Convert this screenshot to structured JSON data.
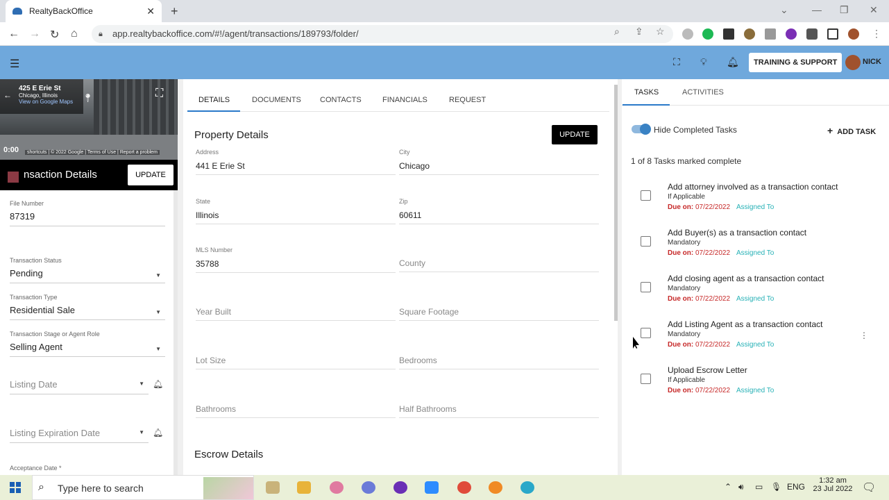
{
  "browser": {
    "tab_title": "RealtyBackOffice",
    "url": "app.realtybackoffice.com/#!/agent/transactions/189793/folder/"
  },
  "header": {
    "support_label": "TRAINING & SUPPORT",
    "user_name": "NICK"
  },
  "streetview": {
    "address": "425 E Erie St",
    "city": "Chicago, Illinois",
    "link": "View on Google Maps",
    "time": "0:00",
    "footer": "shortcuts | © 2022 Google | Terms of Use | Report a problem"
  },
  "left_panel": {
    "title": "nsaction Details",
    "update_label": "UPDATE",
    "file_number_label": "File Number",
    "file_number": "87319",
    "status_label": "Transaction Status",
    "status": "Pending",
    "type_label": "Transaction Type",
    "type": "Residential Sale",
    "stage_label": "Transaction Stage or Agent Role",
    "stage": "Selling Agent",
    "listing_date": "Listing Date",
    "listing_exp": "Listing Expiration Date",
    "acceptance_label": "Acceptance Date *"
  },
  "center": {
    "tabs": [
      "DETAILS",
      "DOCUMENTS",
      "CONTACTS",
      "FINANCIALS",
      "REQUEST"
    ],
    "section_title": "Property Details",
    "update_label": "UPDATE",
    "address_label": "Address",
    "address": "441 E Erie St",
    "city_label": "City",
    "city": "Chicago",
    "state_label": "State",
    "state": "Illinois",
    "zip_label": "Zip",
    "zip": "60611",
    "mls_label": "MLS Number",
    "mls": "35788",
    "county": "County",
    "year_built": "Year Built",
    "square_footage": "Square Footage",
    "lot_size": "Lot Size",
    "bedrooms": "Bedrooms",
    "bathrooms": "Bathrooms",
    "half_bathrooms": "Half Bathrooms",
    "escrow_title": "Escrow Details"
  },
  "right": {
    "tabs": [
      "TASKS",
      "ACTIVITIES"
    ],
    "hide_completed": "Hide Completed Tasks",
    "add_task": "ADD TASK",
    "count_text": "1 of 8 Tasks marked complete",
    "due_prefix": "Due on:",
    "assigned_label": "Assigned To",
    "tasks": [
      {
        "title": "Add attorney involved as a transaction contact",
        "sub": "If Applicable",
        "due": "07/22/2022"
      },
      {
        "title": "Add Buyer(s) as a transaction contact",
        "sub": "Mandatory",
        "due": "07/22/2022"
      },
      {
        "title": "Add closing agent as a transaction contact",
        "sub": "Mandatory",
        "due": "07/22/2022"
      },
      {
        "title": "Add Listing Agent as a transaction contact",
        "sub": "Mandatory",
        "due": "07/22/2022"
      },
      {
        "title": "Upload Escrow Letter",
        "sub": "If Applicable",
        "due": "07/22/2022"
      }
    ]
  },
  "taskbar": {
    "search_placeholder": "Type here to search",
    "lang": "ENG",
    "time": "1:32 am",
    "date": "23 Jul 2022"
  },
  "colors": {
    "appbar": "#6fa8dc",
    "accent": "#2979c9",
    "due": "#c62828",
    "assigned": "#26b1b6"
  }
}
